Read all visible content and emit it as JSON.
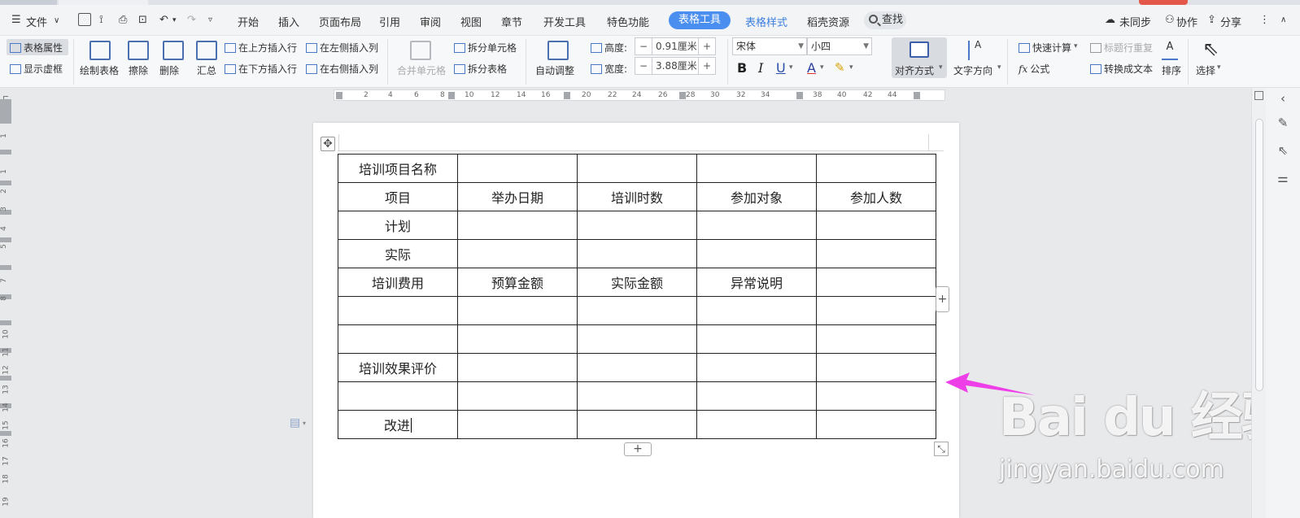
{
  "menu": {
    "file": "文件",
    "tabs": [
      "开始",
      "插入",
      "页面布局",
      "引用",
      "审阅",
      "视图",
      "章节",
      "开发工具",
      "特色功能"
    ],
    "active_tab": "表格工具",
    "table_style": "表格样式",
    "resources": "稻壳资源",
    "search": "查找",
    "unsync": "未同步",
    "collab": "协作",
    "share": "分享"
  },
  "ribbon": {
    "table_props": "表格属性",
    "show_gridlines": "显示虚框",
    "draw_table": "绘制表格",
    "erase": "擦除",
    "delete": "删除",
    "summary": "汇总",
    "insert_above": "在上方插入行",
    "insert_below": "在下方插入行",
    "insert_left": "在左侧插入列",
    "insert_right": "在右侧插入列",
    "merge_cells": "合并单元格",
    "split_cells": "拆分单元格",
    "split_table": "拆分表格",
    "auto_adjust": "自动调整",
    "height_label": "高度:",
    "height_value": "0.91厘米",
    "width_label": "宽度:",
    "width_value": "3.88厘米",
    "font": "宋体",
    "font_size": "小四",
    "bold": "B",
    "italic": "I",
    "underline": "U",
    "font_color": "A",
    "align": "对齐方式",
    "text_direction": "文字方向",
    "quick_calc": "快速计算",
    "title_repeat": "标题行重复",
    "formula": "公式",
    "to_text": "转换成文本",
    "sort": "排序",
    "select": "选择"
  },
  "ruler": {
    "h_ticks": [
      "2",
      "4",
      "6",
      "8",
      "10",
      "12",
      "14",
      "16",
      "18",
      "20",
      "22",
      "24",
      "26",
      "28",
      "30",
      "32",
      "34",
      "36",
      "38",
      "40",
      "42",
      "44"
    ],
    "v_ticks": [
      "1",
      "1",
      "2",
      "3",
      "4",
      "5",
      "7",
      "8",
      "10",
      "11",
      "12",
      "13",
      "14",
      "15",
      "16",
      "17",
      "18",
      "19"
    ]
  },
  "table": {
    "rows": [
      [
        "培训项目名称",
        "",
        "",
        "",
        ""
      ],
      [
        "项目",
        "举办日期",
        "培训时数",
        "参加对象",
        "参加人数"
      ],
      [
        "计划",
        "",
        "",
        "",
        ""
      ],
      [
        "实际",
        "",
        "",
        "",
        ""
      ],
      [
        "培训费用",
        "预算金额",
        "实际金额",
        "异常说明",
        ""
      ],
      [
        "",
        "",
        "",
        "",
        ""
      ],
      [
        "",
        "",
        "",
        "",
        ""
      ],
      [
        "培训效果评价",
        "",
        "",
        "",
        ""
      ],
      [
        "",
        "",
        "",
        "",
        ""
      ],
      [
        "改进",
        "",
        "",
        "",
        ""
      ]
    ]
  },
  "watermark": {
    "logo": "Bai du 经验",
    "site": "jingyan.baidu.com"
  },
  "colors": {
    "accent": "#4a8ff0",
    "arrow": "#ee3ee8"
  }
}
